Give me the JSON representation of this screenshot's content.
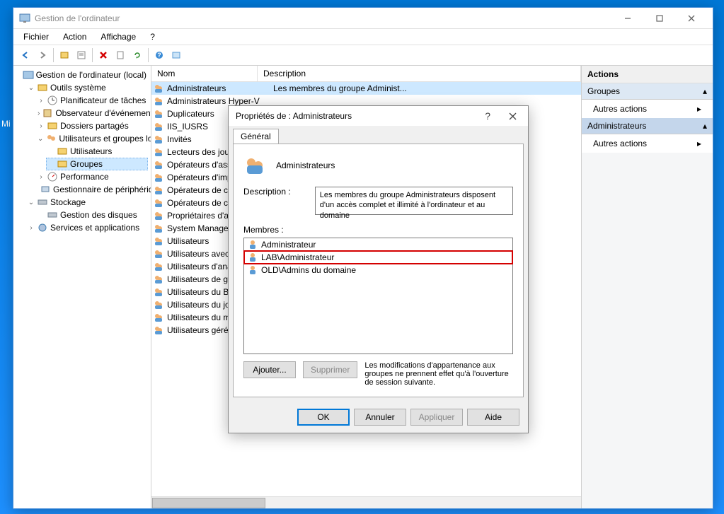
{
  "mi_label": "Mi",
  "window": {
    "title": "Gestion de l'ordinateur",
    "menu": {
      "file": "Fichier",
      "action": "Action",
      "view": "Affichage",
      "help": "?"
    }
  },
  "tree": {
    "root": "Gestion de l'ordinateur (local)",
    "sys": "Outils système",
    "sched": "Planificateur de tâches",
    "event": "Observateur d'événements",
    "shared": "Dossiers partagés",
    "users_groups": "Utilisateurs et groupes locaux",
    "users": "Utilisateurs",
    "groups": "Groupes",
    "perf": "Performance",
    "devmgr": "Gestionnaire de périphériques",
    "storage": "Stockage",
    "diskmgr": "Gestion des disques",
    "services": "Services et applications"
  },
  "list": {
    "col_name": "Nom",
    "col_desc": "Description",
    "rows": [
      {
        "name": "Administrateurs",
        "desc": "Les membres du groupe Administ..."
      },
      {
        "name": "Administrateurs Hyper-V",
        "desc": ""
      },
      {
        "name": "Duplicateurs",
        "desc": ""
      },
      {
        "name": "IIS_IUSRS",
        "desc": ""
      },
      {
        "name": "Invités",
        "desc": ""
      },
      {
        "name": "Lecteurs des journaux d'événements",
        "desc": ""
      },
      {
        "name": "Opérateurs d'assistance de contrôle d'accès",
        "desc": ""
      },
      {
        "name": "Opérateurs d'impression",
        "desc": ""
      },
      {
        "name": "Opérateurs de chiffrement",
        "desc": ""
      },
      {
        "name": "Opérateurs de configuration réseau",
        "desc": ""
      },
      {
        "name": "Propriétaires d'appareils",
        "desc": ""
      },
      {
        "name": "System Managed Accounts Group",
        "desc": ""
      },
      {
        "name": "Utilisateurs",
        "desc": ""
      },
      {
        "name": "Utilisateurs avec pouvoir",
        "desc": ""
      },
      {
        "name": "Utilisateurs d'analyse de performances",
        "desc": ""
      },
      {
        "name": "Utilisateurs de gestion à distance",
        "desc": ""
      },
      {
        "name": "Utilisateurs du Bureau à distance",
        "desc": ""
      },
      {
        "name": "Utilisateurs du journal de performances",
        "desc": ""
      },
      {
        "name": "Utilisateurs du modèle COM distribué",
        "desc": ""
      },
      {
        "name": "Utilisateurs gérés par le système",
        "desc": ""
      }
    ]
  },
  "actions": {
    "header": "Actions",
    "sec1": "Groupes",
    "other": "Autres actions",
    "sec2": "Administrateurs"
  },
  "dialog": {
    "title": "Propriétés de : Administrateurs",
    "tab": "Général",
    "name": "Administrateurs",
    "desc_label": "Description :",
    "desc_value": "Les membres du groupe Administrateurs disposent d'un accès complet et illimité à l'ordinateur et au domaine",
    "members_label": "Membres :",
    "members": [
      "Administrateur",
      "LAB\\Administrateur",
      "OLD\\Admins du domaine"
    ],
    "add": "Ajouter...",
    "remove": "Supprimer",
    "note": "Les modifications d'appartenance aux groupes ne prennent effet qu'à l'ouverture de session suivante.",
    "ok": "OK",
    "cancel": "Annuler",
    "apply": "Appliquer",
    "help": "Aide"
  }
}
